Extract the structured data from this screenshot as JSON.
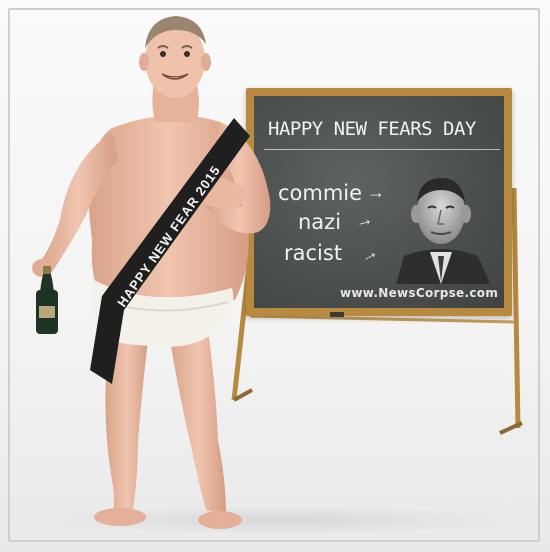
{
  "chalkboard": {
    "title": "HAPPY NEW FEARS DAY",
    "words": [
      "commie",
      "nazi",
      "racist"
    ],
    "watermark": "www.NewsCorpse.com"
  },
  "sash": {
    "text": "HAPPY NEW FEAR 2015"
  },
  "colors": {
    "background": "#f3f3f3",
    "board_frame": "#b78a3f",
    "board_surface": "#4a4f4e",
    "chalk": "#f1f1f1",
    "skin": "#e9b9a3",
    "sash": "#1f1f1f",
    "diaper": "#f3f1ea",
    "bottle": "#1d3324"
  },
  "icons": [
    "champagne-bottle-icon"
  ]
}
